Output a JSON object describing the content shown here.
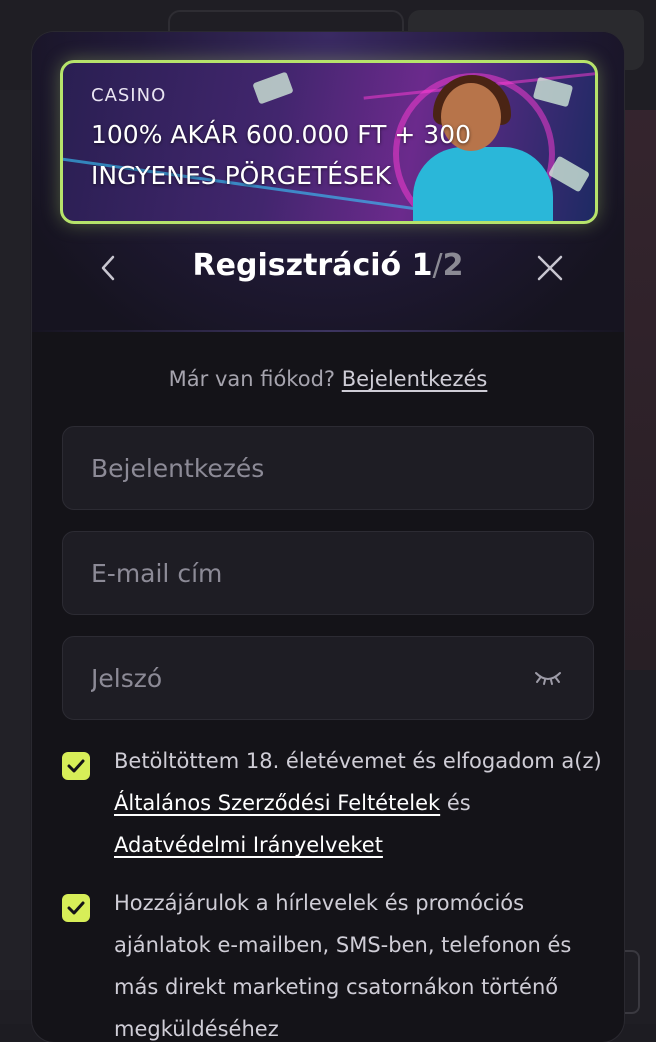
{
  "banner": {
    "kicker": "CASINO",
    "title_line1": "100% AKÁR 600.000 FT + 300",
    "title_line2": "INGYENES PÖRGETÉSEK"
  },
  "header": {
    "title": "Regisztráció",
    "step": "1",
    "separator": "/",
    "total": "2"
  },
  "login_prompt": {
    "text": "Már van fiókod?",
    "link": "Bejelentkezés"
  },
  "form": {
    "username_placeholder": "Bejelentkezés",
    "email_placeholder": "E-mail cím",
    "password_placeholder": "Jelszó"
  },
  "consents": {
    "age_prefix": "Betöltöttem 18. életévemet és elfogadom a(z)",
    "terms_link": "Általános Szerződési Feltételek",
    "and_word": "és",
    "privacy_link": "Adatvédelmi Irányelveket",
    "marketing_text": "Hozzájárulok a hírlevelek és promóciós ajánlatok e-mailben, SMS-ben, telefonon és más direkt marketing csatornákon történő megküldéséhez"
  },
  "colors": {
    "accent": "#d7ee58",
    "banner_border": "#b6e36b",
    "modal_bg": "#141318",
    "field_bg": "#1e1d24"
  },
  "icons": [
    "chevron-left-icon",
    "close-icon",
    "eye-closed-icon",
    "checkmark-icon"
  ]
}
